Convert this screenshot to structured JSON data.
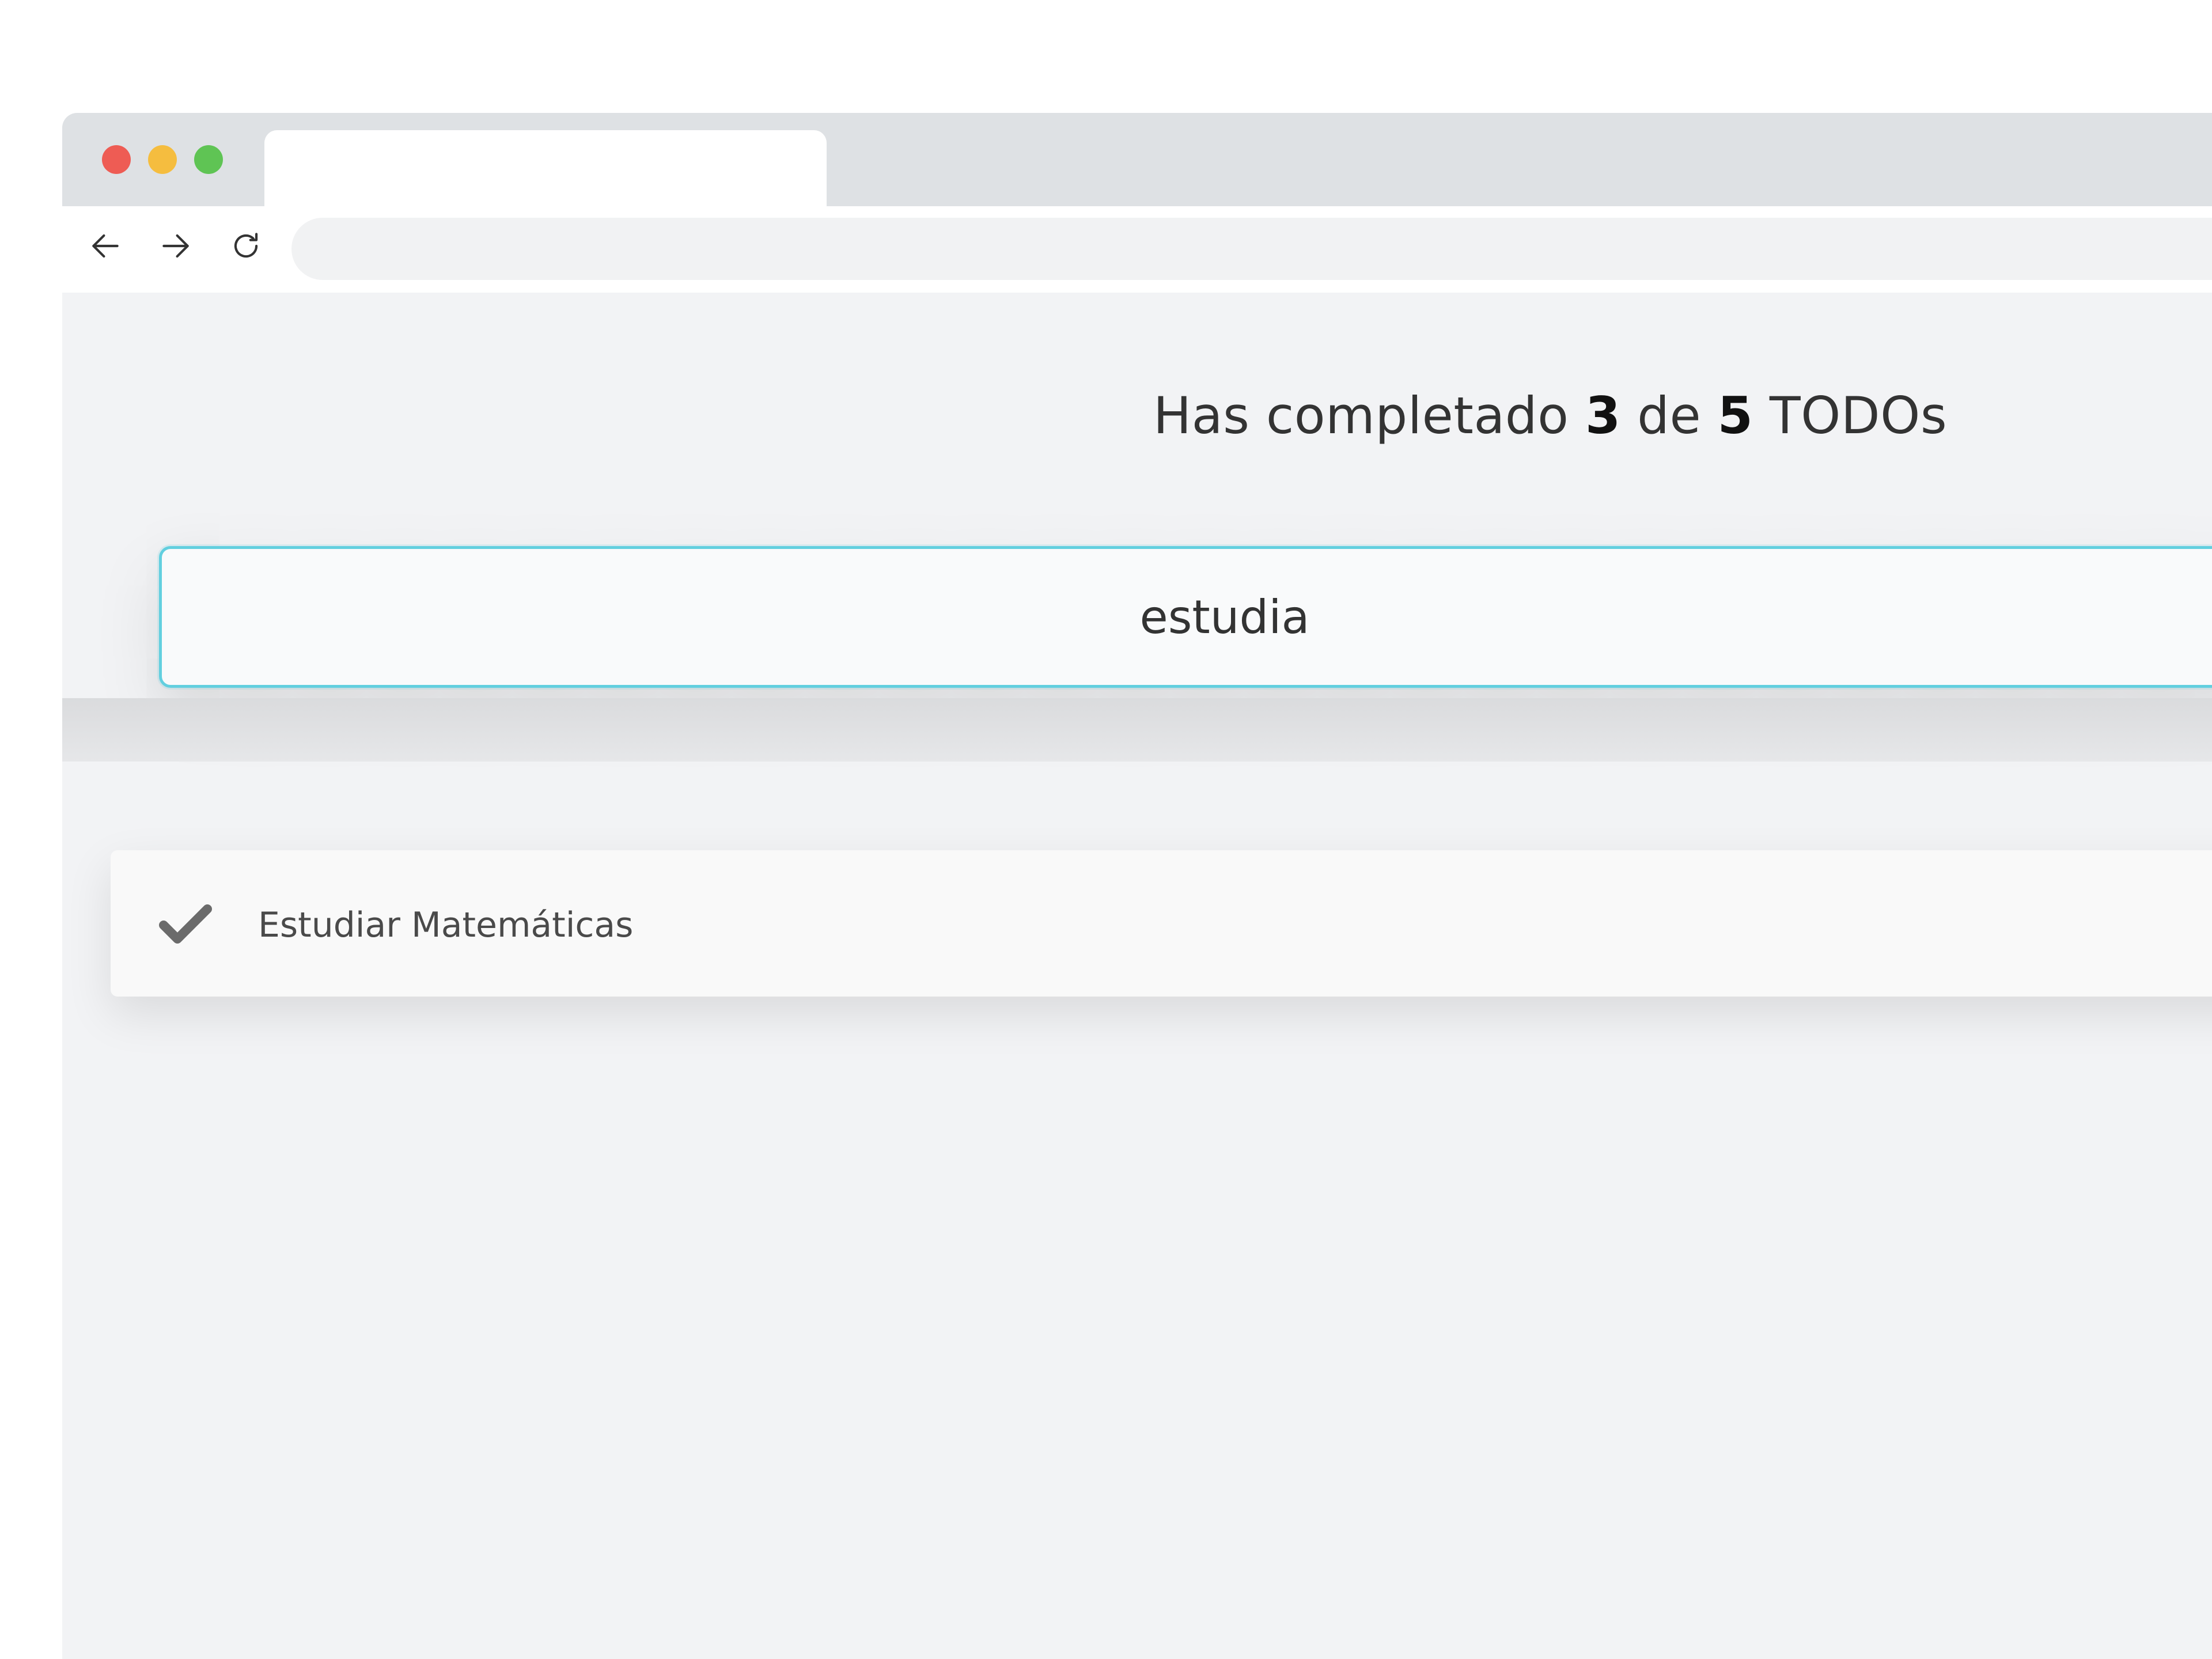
{
  "browser": {
    "tab_title": "",
    "url": ""
  },
  "counter": {
    "prefix": "Has completado",
    "completed": "3",
    "middle": "de",
    "total": "5",
    "suffix": "TODOs"
  },
  "search": {
    "value": "estudia",
    "placeholder": ""
  },
  "todos": [
    {
      "text": "Estudiar Matemáticas",
      "completed": true
    }
  ],
  "colors": {
    "accent": "#62cfdf",
    "dot_red": "#ee5c54",
    "dot_yellow": "#f5bd3f",
    "dot_green": "#5fc454"
  },
  "icons": [
    "back-arrow-icon",
    "forward-arrow-icon",
    "reload-icon",
    "check-icon"
  ]
}
